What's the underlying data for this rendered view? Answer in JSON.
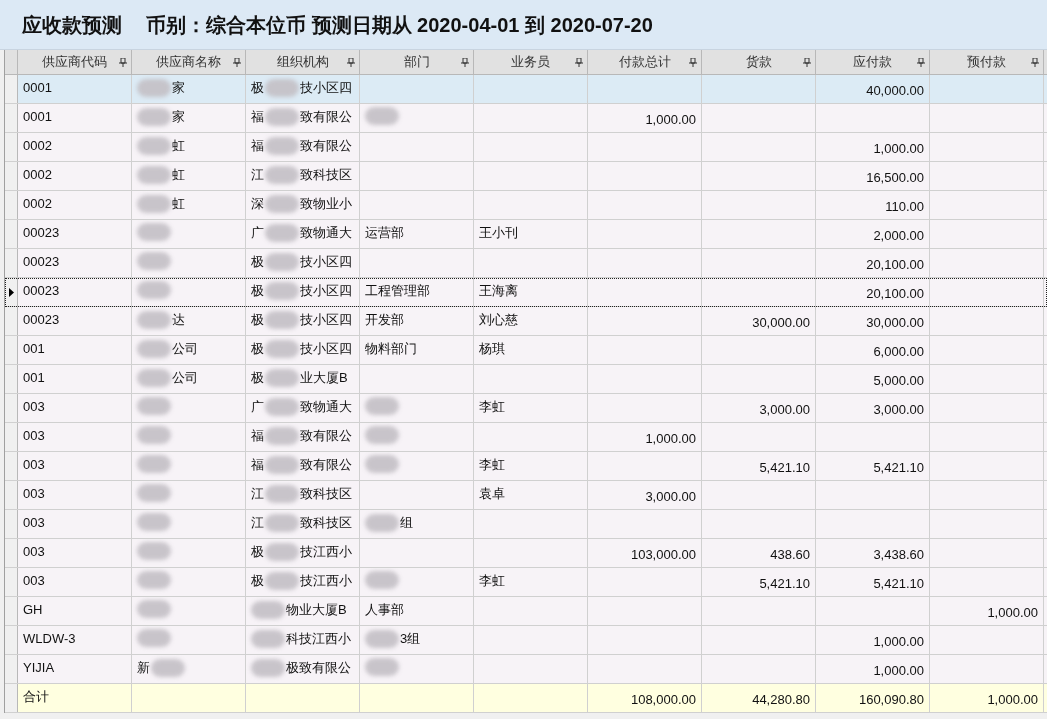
{
  "title": {
    "heading": "应收款预测",
    "subtitle": "币别：综合本位币 预测日期从 2020-04-01 到 2020-07-20"
  },
  "columns": [
    {
      "label": "供应商代码",
      "kind": "text"
    },
    {
      "label": "供应商名称",
      "kind": "text"
    },
    {
      "label": "组织机构",
      "kind": "text"
    },
    {
      "label": "部门",
      "kind": "text"
    },
    {
      "label": "业务员",
      "kind": "text"
    },
    {
      "label": "付款总计",
      "kind": "amount"
    },
    {
      "label": "货款",
      "kind": "amount"
    },
    {
      "label": "应付款",
      "kind": "amount"
    },
    {
      "label": "预付款",
      "kind": "amount"
    }
  ],
  "rows": [
    {
      "selected": true,
      "current": false,
      "cells": [
        "0001",
        {
          "kind": "blurred",
          "after": "家"
        },
        {
          "kind": "blurred",
          "before": "极",
          "after": "技小区四"
        },
        "",
        "",
        "",
        "",
        "40,000.00",
        ""
      ]
    },
    {
      "selected": false,
      "current": false,
      "cells": [
        "0001",
        {
          "kind": "blurred",
          "after": "家"
        },
        {
          "kind": "blurred",
          "before": "福",
          "after": "致有限公"
        },
        {
          "kind": "blurred"
        },
        "",
        "1,000.00",
        "",
        "",
        ""
      ]
    },
    {
      "selected": false,
      "current": false,
      "cells": [
        "0002",
        {
          "kind": "blurred",
          "after": "虹"
        },
        {
          "kind": "blurred",
          "before": "福",
          "after": "致有限公"
        },
        "",
        "",
        "",
        "",
        "1,000.00",
        ""
      ]
    },
    {
      "selected": false,
      "current": false,
      "cells": [
        "0002",
        {
          "kind": "blurred",
          "after": "虹"
        },
        {
          "kind": "blurred",
          "before": "江",
          "after": "致科技区"
        },
        "",
        "",
        "",
        "",
        "16,500.00",
        ""
      ]
    },
    {
      "selected": false,
      "current": false,
      "cells": [
        "0002",
        {
          "kind": "blurred",
          "after": "虹"
        },
        {
          "kind": "blurred",
          "before": "深",
          "after": "致物业小"
        },
        "",
        "",
        "",
        "",
        "110.00",
        ""
      ]
    },
    {
      "selected": false,
      "current": false,
      "cells": [
        "00023",
        {
          "kind": "blurred"
        },
        {
          "kind": "blurred",
          "before": "广",
          "after": "致物通大"
        },
        "运营部",
        "王小刊",
        "",
        "",
        "2,000.00",
        ""
      ]
    },
    {
      "selected": false,
      "current": false,
      "cells": [
        "00023",
        {
          "kind": "blurred"
        },
        {
          "kind": "blurred",
          "before": "极",
          "after": "技小区四"
        },
        "",
        "",
        "",
        "",
        "20,100.00",
        ""
      ]
    },
    {
      "selected": false,
      "current": true,
      "cells": [
        "00023",
        {
          "kind": "blurred"
        },
        {
          "kind": "blurred",
          "before": "极",
          "after": "技小区四"
        },
        "工程管理部",
        "王海离",
        "",
        "",
        "20,100.00",
        ""
      ]
    },
    {
      "selected": false,
      "current": false,
      "cells": [
        "00023",
        {
          "kind": "blurred",
          "after": "达"
        },
        {
          "kind": "blurred",
          "before": "极",
          "after": "技小区四"
        },
        "开发部",
        "刘心慈",
        "",
        "30,000.00",
        "30,000.00",
        ""
      ]
    },
    {
      "selected": false,
      "current": false,
      "cells": [
        "001",
        {
          "kind": "blurred",
          "after": "公司"
        },
        {
          "kind": "blurred",
          "before": "极",
          "after": "技小区四"
        },
        "物料部门",
        "杨琪",
        "",
        "",
        "6,000.00",
        ""
      ]
    },
    {
      "selected": false,
      "current": false,
      "cells": [
        "001",
        {
          "kind": "blurred",
          "after": "公司"
        },
        {
          "kind": "blurred",
          "before": "极",
          "after": "业大厦B"
        },
        "",
        "",
        "",
        "",
        "5,000.00",
        ""
      ]
    },
    {
      "selected": false,
      "current": false,
      "cells": [
        "003",
        {
          "kind": "blurred"
        },
        {
          "kind": "blurred",
          "before": "广",
          "after": "致物通大"
        },
        {
          "kind": "blurred"
        },
        "李虹",
        "",
        "3,000.00",
        "3,000.00",
        ""
      ]
    },
    {
      "selected": false,
      "current": false,
      "cells": [
        "003",
        {
          "kind": "blurred"
        },
        {
          "kind": "blurred",
          "before": "福",
          "after": "致有限公"
        },
        {
          "kind": "blurred"
        },
        "",
        "1,000.00",
        "",
        "",
        ""
      ]
    },
    {
      "selected": false,
      "current": false,
      "cells": [
        "003",
        {
          "kind": "blurred"
        },
        {
          "kind": "blurred",
          "before": "福",
          "after": "致有限公"
        },
        {
          "kind": "blurred"
        },
        "李虹",
        "",
        "5,421.10",
        "5,421.10",
        ""
      ]
    },
    {
      "selected": false,
      "current": false,
      "cells": [
        "003",
        {
          "kind": "blurred"
        },
        {
          "kind": "blurred",
          "before": "江",
          "after": "致科技区"
        },
        "",
        "袁卓",
        "3,000.00",
        "",
        "",
        ""
      ]
    },
    {
      "selected": false,
      "current": false,
      "cells": [
        "003",
        {
          "kind": "blurred"
        },
        {
          "kind": "blurred",
          "before": "江",
          "after": "致科技区"
        },
        {
          "kind": "blurred",
          "after": "组"
        },
        "",
        "",
        "",
        "",
        ""
      ]
    },
    {
      "selected": false,
      "current": false,
      "cells": [
        "003",
        {
          "kind": "blurred"
        },
        {
          "kind": "blurred",
          "before": "极",
          "after": "技江西小"
        },
        "",
        "",
        "103,000.00",
        "438.60",
        "3,438.60",
        ""
      ]
    },
    {
      "selected": false,
      "current": false,
      "cells": [
        "003",
        {
          "kind": "blurred"
        },
        {
          "kind": "blurred",
          "before": "极",
          "after": "技江西小"
        },
        {
          "kind": "blurred"
        },
        "李虹",
        "",
        "5,421.10",
        "5,421.10",
        ""
      ]
    },
    {
      "selected": false,
      "current": false,
      "cells": [
        "GH",
        {
          "kind": "blurred"
        },
        {
          "kind": "blurred",
          "after": "物业大厦B"
        },
        "人事部",
        "",
        "",
        "",
        "",
        "1,000.00"
      ]
    },
    {
      "selected": false,
      "current": false,
      "cells": [
        "WLDW-3",
        {
          "kind": "blurred"
        },
        {
          "kind": "blurred",
          "after": "科技江西小"
        },
        {
          "kind": "blurred",
          "after": "3组"
        },
        "",
        "",
        "",
        "1,000.00",
        ""
      ]
    },
    {
      "selected": false,
      "current": false,
      "cells": [
        "YIJIA",
        {
          "kind": "blurred",
          "before": "新"
        },
        {
          "kind": "blurred",
          "after": "极致有限公"
        },
        {
          "kind": "blurred"
        },
        "",
        "",
        "",
        "1,000.00",
        ""
      ]
    }
  ],
  "total": {
    "cells": [
      "合计",
      "",
      "",
      "",
      "",
      "108,000.00",
      "44,280.80",
      "160,090.80",
      "1,000.00"
    ]
  }
}
